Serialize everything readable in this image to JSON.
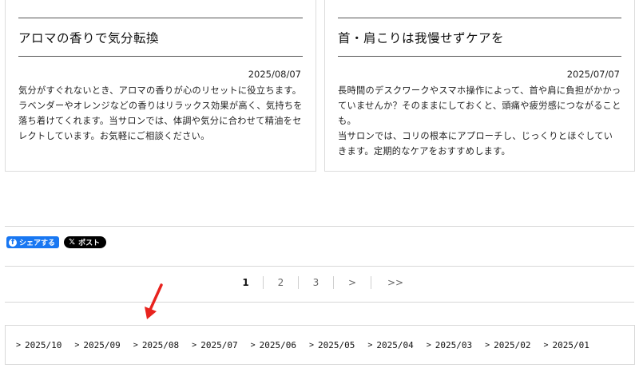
{
  "posts": [
    {
      "title": "アロマの香りで気分転換",
      "date": "2025/08/07",
      "paragraphs": [
        "気分がすぐれないとき、アロマの香りが心のリセットに役立ちます。",
        "ラベンダーやオレンジなどの香りはリラックス効果が高く、気持ちを落ち着けてくれます。当サロンでは、体調や気分に合わせて精油をセレクトしています。お気軽にご相談ください。"
      ]
    },
    {
      "title": "首・肩こりは我慢せずケアを",
      "date": "2025/07/07",
      "paragraphs": [
        "長時間のデスクワークやスマホ操作によって、首や肩に負担がかかっていませんか？そのままにしておくと、頭痛や疲労感につながることも。",
        "当サロンでは、コリの根本にアプローチし、じっくりとほぐしていきます。定期的なケアをおすすめします。"
      ]
    }
  ],
  "share": {
    "facebook_label": "シェアする",
    "x_label": "ポスト",
    "facebook_icon": "f",
    "x_icon": "𝕏"
  },
  "pagination": {
    "pages": [
      "1",
      "2",
      "3"
    ],
    "current": "1",
    "next_label": ">",
    "last_label": ">>"
  },
  "archive": {
    "chevron": ">",
    "months": [
      "2025/10",
      "2025/09",
      "2025/08",
      "2025/07",
      "2025/06",
      "2025/05",
      "2025/04",
      "2025/03",
      "2025/02",
      "2025/01"
    ]
  },
  "colors": {
    "facebook": "#1877f2",
    "x": "#000000",
    "annotation_arrow": "#e8231e"
  }
}
